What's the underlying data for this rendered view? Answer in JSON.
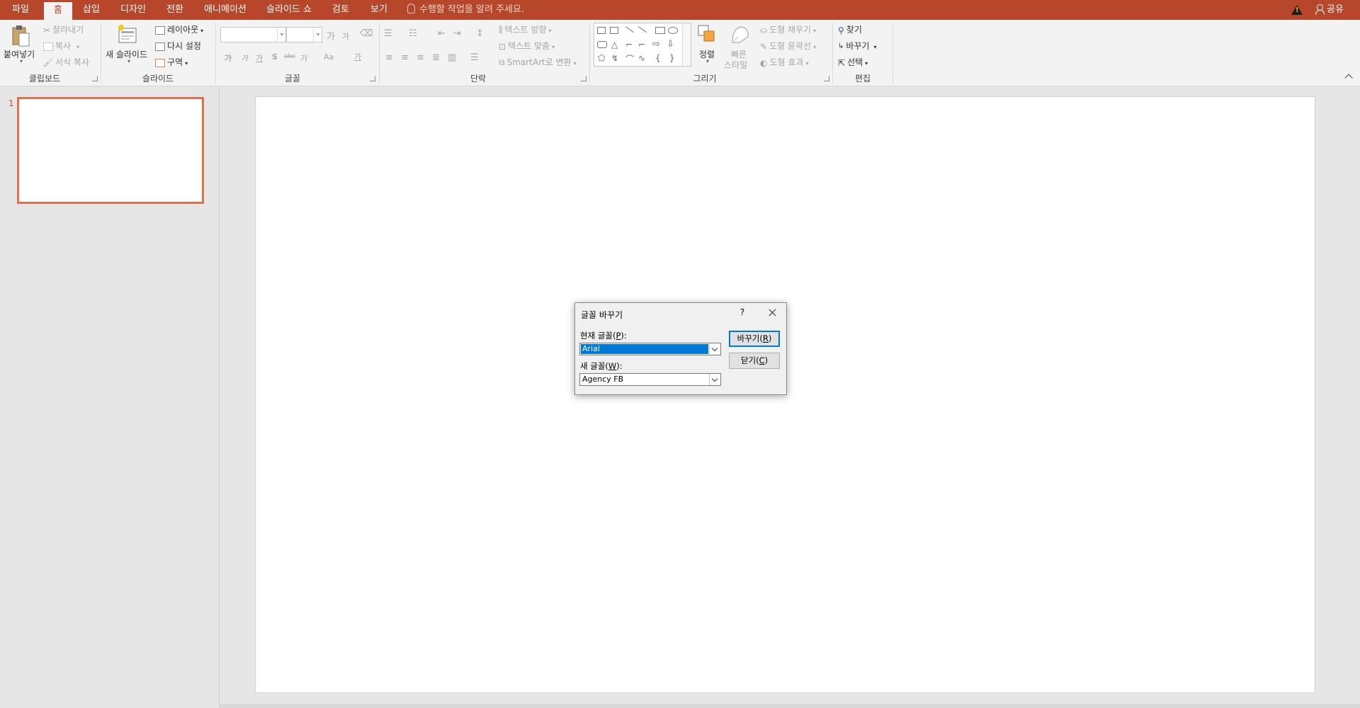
{
  "tabs": {
    "file": "파일",
    "home": "홈",
    "insert": "삽입",
    "design": "디자인",
    "transitions": "전환",
    "animations": "애니메이션",
    "slideshow": "슬라이드 쇼",
    "review": "검토",
    "view": "보기"
  },
  "tell_me": "수행할 작업을 알려 주세요.",
  "share": "공유",
  "ribbon": {
    "clipboard": {
      "label": "클립보드",
      "paste": "붙여넣기",
      "cut": "잘라내기",
      "copy": "복사",
      "format_painter": "서식 복사"
    },
    "slides": {
      "label": "슬라이드",
      "new_slide": "새 슬라이드",
      "layout": "레이아웃",
      "reset": "다시 설정",
      "section": "구역"
    },
    "font": {
      "label": "글꼴",
      "grow": "가",
      "shrink": "가",
      "bold": "가",
      "italic": "가",
      "underline": "가",
      "shadow": "S",
      "strike": "abc",
      "spacing": "가",
      "case": "Aa",
      "color": "가"
    },
    "paragraph": {
      "label": "단락",
      "text_direction": "텍스트 방향",
      "align_text": "텍스트 맞춤",
      "smartart": "SmartArt로 변환"
    },
    "drawing": {
      "label": "그리기",
      "arrange": "정렬",
      "quick_styles_1": "빠른",
      "quick_styles_2": "스타일",
      "shape_fill": "도형 채우기",
      "shape_outline": "도형 윤곽선",
      "shape_effects": "도형 효과"
    },
    "editing": {
      "label": "편집",
      "find": "찾기",
      "replace": "바꾸기",
      "select": "선택"
    }
  },
  "thumbnails": [
    {
      "number": "1"
    }
  ],
  "dialog": {
    "title": "글꼴 바꾸기",
    "help": "?",
    "current_font_label_pre": "현재 글꼴(",
    "current_font_key": "P",
    "current_font_label_post": "):",
    "current_font_value": "Arial",
    "new_font_label_pre": "새 글꼴(",
    "new_font_key": "W",
    "new_font_label_post": "):",
    "new_font_value": "Agency FB",
    "replace_pre": "바꾸기(",
    "replace_key": "R",
    "replace_post": ")",
    "close_pre": "닫기(",
    "close_key": "C",
    "close_post": ")"
  },
  "colors": {
    "accent": "#b7472a",
    "selection": "#0078d7"
  }
}
